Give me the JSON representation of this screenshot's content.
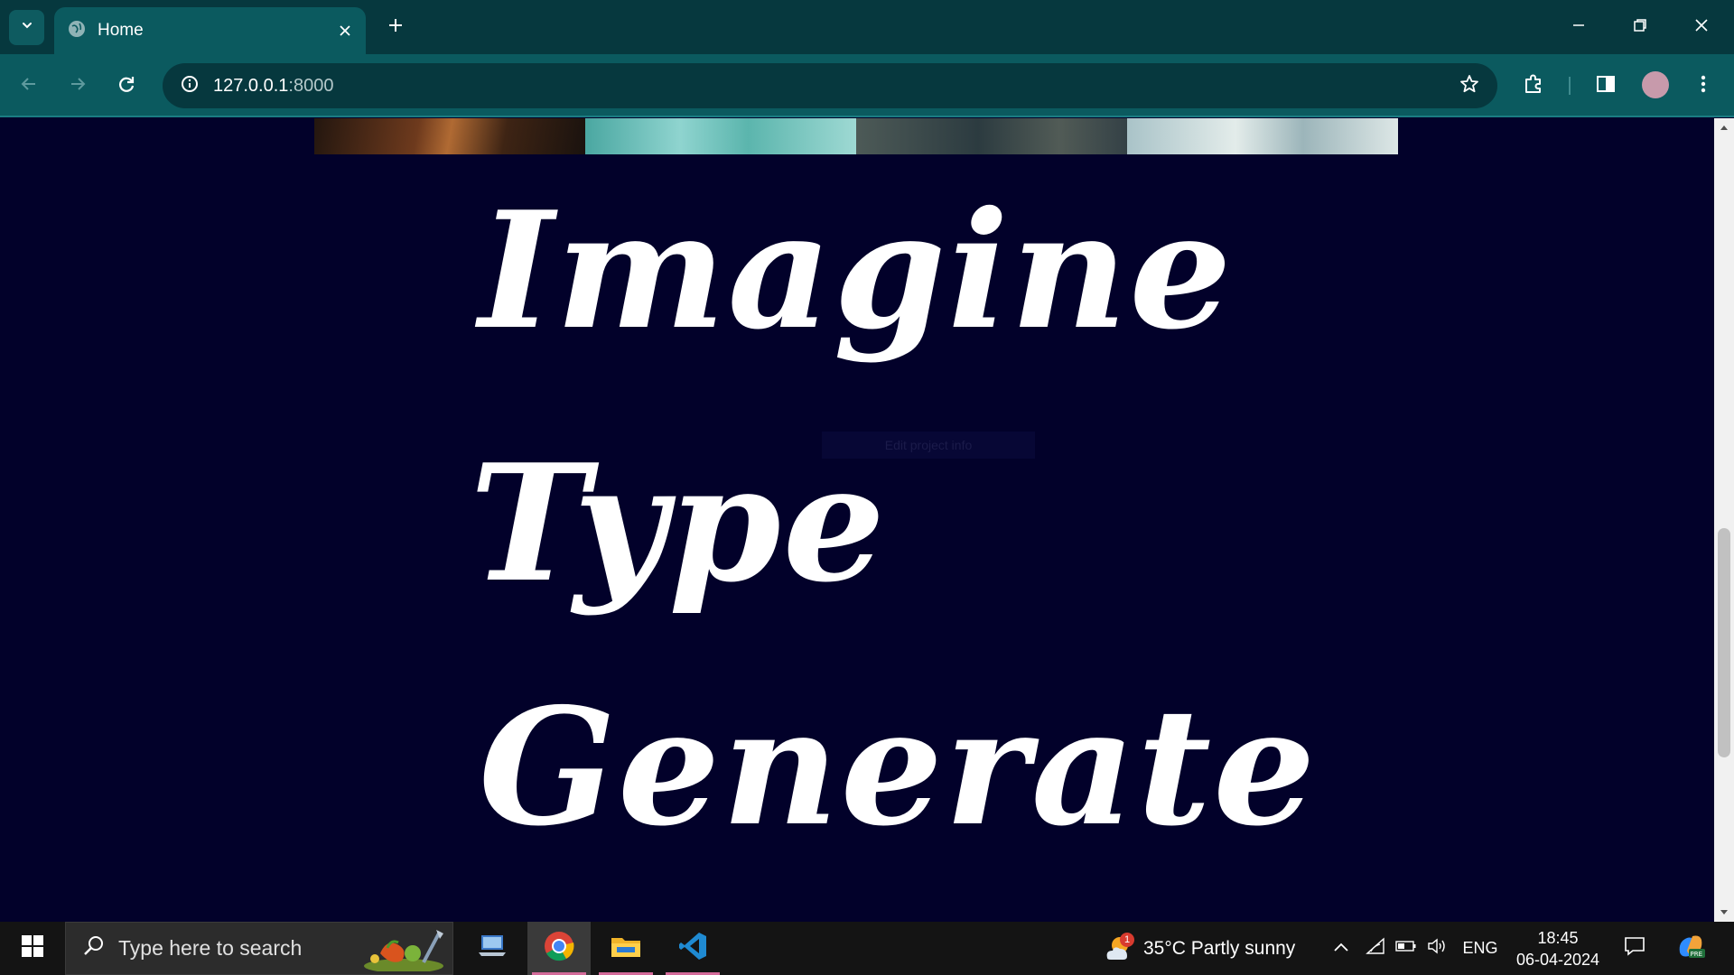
{
  "browser": {
    "tab": {
      "title": "Home"
    },
    "url": {
      "host": "127.0.0.1",
      "port": ":8000"
    }
  },
  "page": {
    "words": [
      "Imagine",
      "Type",
      "Generate"
    ],
    "faint_label": "Edit project info"
  },
  "taskbar": {
    "search_placeholder": "Type here to search",
    "weather": {
      "badge": "1",
      "text": "35°C  Partly sunny"
    },
    "language": "ENG",
    "time": "18:45",
    "date": "06-04-2024"
  },
  "colors": {
    "page_bg": "#02012a",
    "chrome_bg": "#0b5a5f",
    "tab_strip_bg": "#06383e",
    "taskbar_bg": "#141414",
    "avatar": "#c79aab"
  }
}
